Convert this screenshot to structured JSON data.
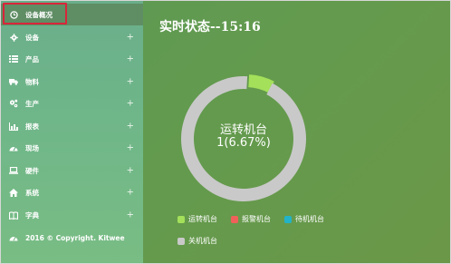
{
  "sidebar": {
    "items": [
      {
        "label": "设备概况",
        "icon": "clock-icon",
        "active": true,
        "has_plus": false
      },
      {
        "label": "设备",
        "icon": "gear-icon",
        "active": false,
        "has_plus": true
      },
      {
        "label": "产品",
        "icon": "list-icon",
        "active": false,
        "has_plus": true
      },
      {
        "label": "物料",
        "icon": "truck-icon",
        "active": false,
        "has_plus": true
      },
      {
        "label": "生产",
        "icon": "gears-icon",
        "active": false,
        "has_plus": true
      },
      {
        "label": "报表",
        "icon": "chart-icon",
        "active": false,
        "has_plus": true
      },
      {
        "label": "现场",
        "icon": "dashboard-icon",
        "active": false,
        "has_plus": true
      },
      {
        "label": "硬件",
        "icon": "laptop-icon",
        "active": false,
        "has_plus": true
      },
      {
        "label": "系统",
        "icon": "home-icon",
        "active": false,
        "has_plus": true
      },
      {
        "label": "字典",
        "icon": "book-icon",
        "active": false,
        "has_plus": true
      }
    ],
    "plus_symbol": "+",
    "footer": "2016 © Copyright. Kitwee"
  },
  "main": {
    "title": "实时状态--15:16"
  },
  "chart_data": {
    "type": "pie",
    "donut": true,
    "center_label": "运转机台",
    "center_value": "1(6.67%)",
    "slices": [
      {
        "name": "运转机台",
        "value": 1,
        "color": "#a4e05a"
      },
      {
        "name": "报警机台",
        "value": 0,
        "color": "#f0605a"
      },
      {
        "name": "待机机台",
        "value": 0,
        "color": "#22b3c8"
      },
      {
        "name": "关机机台",
        "value": 14,
        "color": "#c9c9c9"
      }
    ],
    "legend_position": "bottom-left"
  }
}
